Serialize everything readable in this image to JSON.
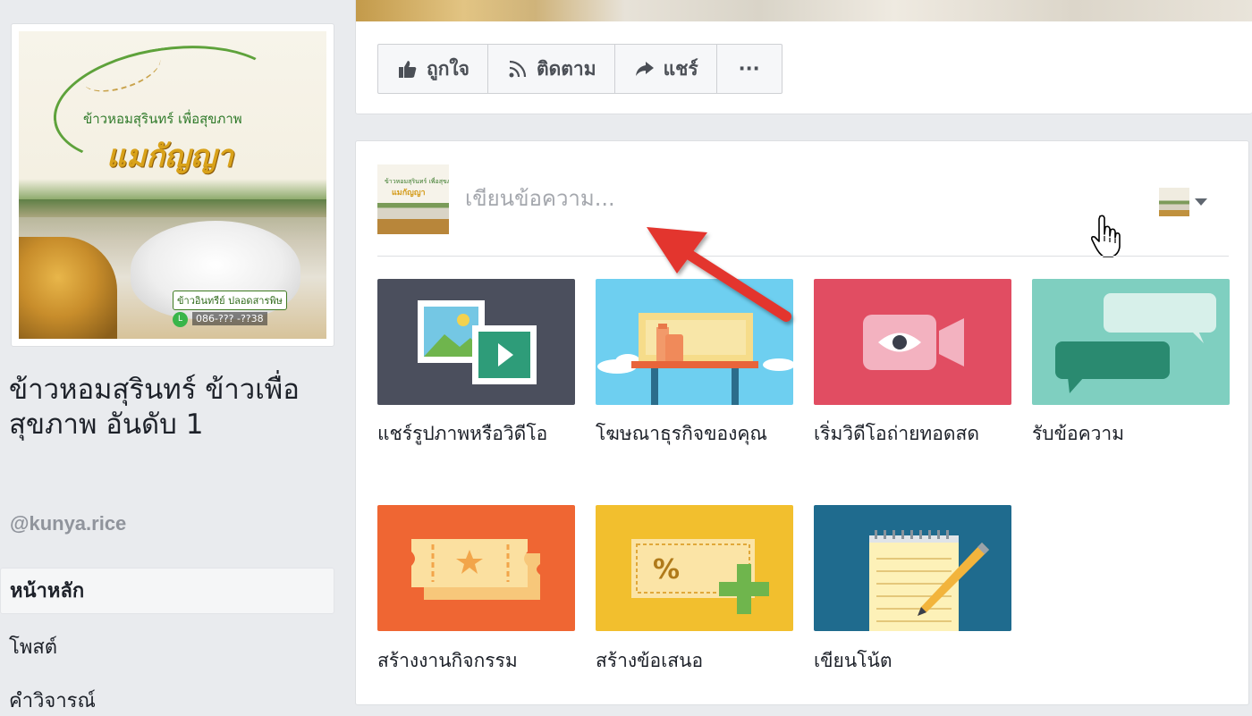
{
  "page": {
    "name": "ข้าวหอมสุรินทร์ ข้าวเพื่อสุขภาพ อันดับ 1",
    "handle": "@kunya.rice",
    "profile_image": {
      "brand_top": "ข้าวหอมสุรินทร์ เพื่อสุขภาพ",
      "brand_main": "แมกัญญา",
      "tagline": "ข้าวอินทรีย์ ปลอดสารพิษ",
      "phone": "086-??? -??38"
    }
  },
  "nav": {
    "items": [
      {
        "label": "หน้าหลัก",
        "active": true
      },
      {
        "label": "โพสต์",
        "active": false
      },
      {
        "label": "คำวิจารณ์",
        "active": false
      }
    ]
  },
  "actions": {
    "like": "ถูกใจ",
    "follow": "ติดตาม",
    "share": "แชร์",
    "more": "···"
  },
  "composer": {
    "placeholder": "เขียนข้อความ...",
    "options": [
      {
        "label": "แชร์รูปภาพหรือวิดีโอ",
        "icon": "photo-video-icon",
        "color": "#4b4f5d"
      },
      {
        "label": "โฆษณาธุรกิจของคุณ",
        "icon": "advertise-icon",
        "color": "#6ecff0"
      },
      {
        "label": "เริ่มวิดีโอถ่ายทอดสด",
        "icon": "live-video-icon",
        "color": "#e14d62"
      },
      {
        "label": "รับข้อความ",
        "icon": "messages-icon",
        "color": "#7fcfc0"
      },
      {
        "label": "สร้างงานกิจกรรม",
        "icon": "event-ticket-icon",
        "color": "#ef6633"
      },
      {
        "label": "สร้างข้อเสนอ",
        "icon": "offer-coupon-icon",
        "color": "#f2bf2e"
      },
      {
        "label": "เขียนโน้ต",
        "icon": "note-icon",
        "color": "#1f6b8e"
      }
    ]
  },
  "colors": {
    "background": "#e9ebee",
    "arrow": "#e3342f"
  }
}
